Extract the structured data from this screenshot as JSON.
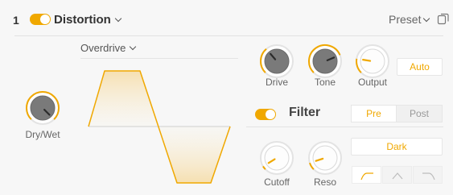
{
  "header": {
    "slot_number": "1",
    "effect_name": "Distortion",
    "preset_label": "Preset"
  },
  "distortion": {
    "mode": "Overdrive",
    "enabled": true
  },
  "knobs": {
    "dry_wet": {
      "label": "Dry/Wet",
      "value": 1.0
    },
    "drive": {
      "label": "Drive",
      "value": 0.35
    },
    "tone": {
      "label": "Tone",
      "value": 0.75
    },
    "output": {
      "label": "Output",
      "value": 0.2
    },
    "cutoff": {
      "label": "Cutoff",
      "value": 0.05
    },
    "reso": {
      "label": "Reso",
      "value": 0.1
    }
  },
  "auto_button": {
    "label": "Auto"
  },
  "filter": {
    "title": "Filter",
    "enabled": true,
    "routing": {
      "options": [
        "Pre",
        "Post"
      ],
      "selected": "Pre"
    },
    "type_button": "Dark",
    "shapes": [
      {
        "name": "low-pass",
        "selected": true
      },
      {
        "name": "band-pass",
        "selected": false
      },
      {
        "name": "high-pass",
        "selected": false
      }
    ]
  },
  "colors": {
    "accent": "#f0a800",
    "background": "#f7f7f7",
    "knob_body": "#7a7a7a"
  }
}
